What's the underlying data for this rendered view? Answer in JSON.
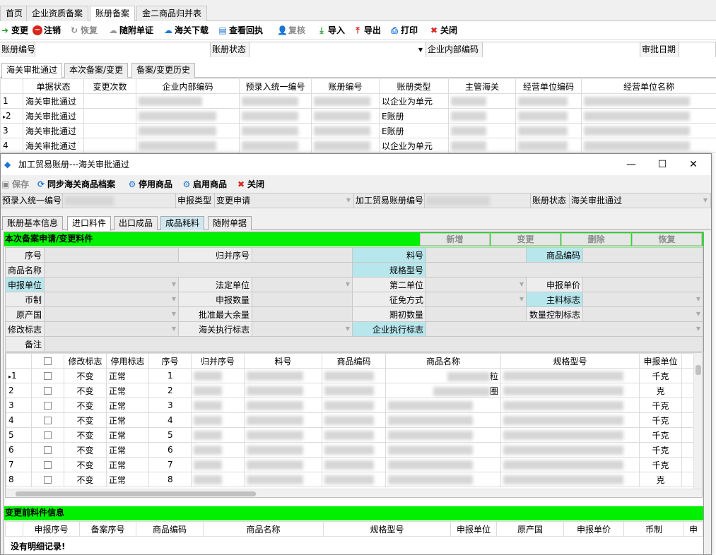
{
  "tabs": [
    "首页",
    "企业资质备案",
    "账册备案",
    "金二商品归并表"
  ],
  "toolbar": {
    "change": "变更",
    "cancel": "注销",
    "restore": "恢复",
    "follow_doc": "随附单证",
    "customs_download": "海关下载",
    "view_receipt": "查看回执",
    "recheck": "复核",
    "import": "导入",
    "export": "导出",
    "print": "打印",
    "close": "关闭"
  },
  "query": {
    "account_no": "账册编号",
    "account_status": "账册状态",
    "internal_no": "企业内部编码",
    "approve_date": "审批日期"
  },
  "subtabs": [
    "海关审批通过",
    "本次备案/变更",
    "备案/变更历史"
  ],
  "main_table": {
    "headers": [
      "单据状态",
      "变更次数",
      "企业内部编码",
      "预录入统一编号",
      "账册编号",
      "账册类型",
      "主管海关",
      "经营单位编码",
      "经营单位名称"
    ],
    "rows": [
      {
        "no": "1",
        "status": "海关审批通过",
        "type": "以企业为单元"
      },
      {
        "no": "2",
        "status": "海关审批通过",
        "type": "E账册"
      },
      {
        "no": "3",
        "status": "海关审批通过",
        "type": "E账册"
      },
      {
        "no": "4",
        "status": "海关审批通过",
        "type": "以企业为单元"
      }
    ]
  },
  "dialog": {
    "title": "加工贸易账册---海关审批通过",
    "toolbar": {
      "save": "保存",
      "sync": "同步海关商品档案",
      "disable": "停用商品",
      "enable": "启用商品",
      "close": "关闭"
    },
    "fields": {
      "pre_entry_no": "预录入统一编号",
      "declare_type": "申报类型",
      "declare_type_value": "变更申请",
      "account_no": "加工贸易账册编号",
      "status": "账册状态",
      "status_value": "海关审批通过"
    },
    "tabs": [
      "账册基本信息",
      "进口料件",
      "出口成品",
      "成品耗料",
      "随附单据"
    ],
    "section_title": "本次备案申请/变更料件",
    "section_buttons": [
      "新增",
      "变更",
      "删除",
      "恢复"
    ],
    "form": {
      "seq": "序号",
      "merge_seq": "归并序号",
      "material_no": "料号",
      "goods_code": "商品编码",
      "goods_name": "商品名称",
      "spec": "规格型号",
      "decl_unit": "申报单位",
      "legal_unit": "法定单位",
      "second_unit": "第二单位",
      "decl_price": "申报单价",
      "currency": "币制",
      "decl_qty": "申报数量",
      "tax_mode": "征免方式",
      "main_flag": "主料标志",
      "origin": "原产国",
      "max_remain": "批准最大余量",
      "init_qty": "期初数量",
      "qty_ctrl": "数量控制标志",
      "modify_flag": "修改标志",
      "customs_flag": "海关执行标志",
      "ent_flag": "企业执行标志",
      "remark": "备注"
    },
    "grid": {
      "headers": [
        "修改标志",
        "停用标志",
        "序号",
        "归并序号",
        "料号",
        "商品编码",
        "商品名称",
        "规格型号",
        "申报单位"
      ],
      "rows": [
        {
          "n": "1",
          "mod": "不变",
          "stop": "正常",
          "seq": "1",
          "name_tail": "粒",
          "unit": "千克"
        },
        {
          "n": "2",
          "mod": "不变",
          "stop": "正常",
          "seq": "2",
          "name_tail": "圈",
          "unit": "克"
        },
        {
          "n": "3",
          "mod": "不变",
          "stop": "正常",
          "seq": "3",
          "name_tail": "",
          "unit": "千克"
        },
        {
          "n": "4",
          "mod": "不变",
          "stop": "正常",
          "seq": "4",
          "name_tail": "",
          "unit": "千克"
        },
        {
          "n": "5",
          "mod": "不变",
          "stop": "正常",
          "seq": "5",
          "name_tail": "",
          "unit": "千克"
        },
        {
          "n": "6",
          "mod": "不变",
          "stop": "正常",
          "seq": "6",
          "name_tail": "",
          "unit": "千克"
        },
        {
          "n": "7",
          "mod": "不变",
          "stop": "正常",
          "seq": "7",
          "name_tail": "",
          "unit": "千克"
        },
        {
          "n": "8",
          "mod": "不变",
          "stop": "正常",
          "seq": "8",
          "name_tail": "",
          "unit": "克"
        }
      ]
    },
    "before_title": "变更前料件信息",
    "before_headers": [
      "申报序号",
      "备案序号",
      "商品编码",
      "商品名称",
      "规格型号",
      "申报单位",
      "原产国",
      "申报单价",
      "币制",
      "申"
    ],
    "no_records": "没有明细记录!"
  }
}
